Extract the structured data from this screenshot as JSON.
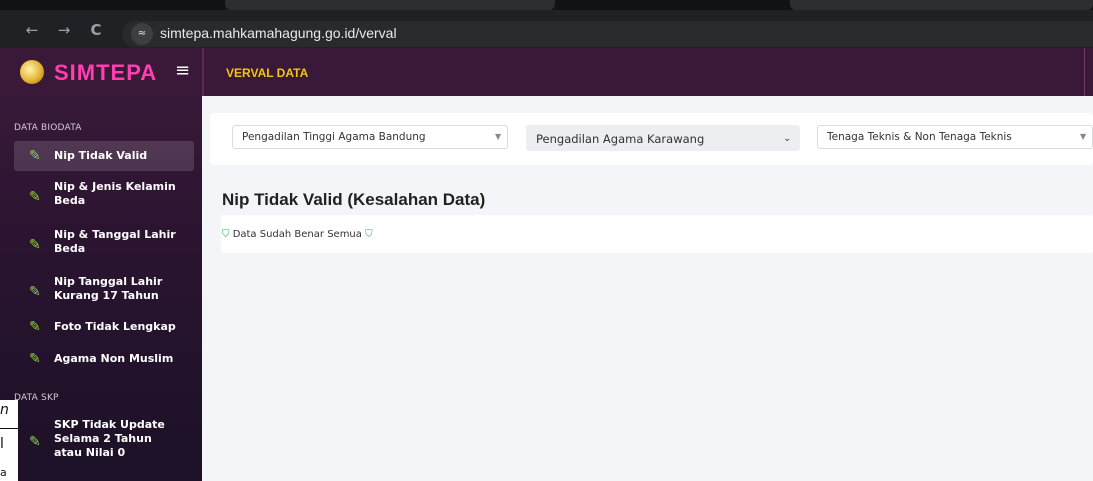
{
  "browser": {
    "url": "simtepa.mahkamahagung.go.id/verval",
    "back_icon": "←",
    "forward_icon": "→",
    "reload_icon": "C",
    "site_icon": "≈"
  },
  "brand": {
    "name": "SIMTEPA",
    "menu_icon": "≡"
  },
  "header": {
    "title": "VERVAL DATA"
  },
  "sidebar": {
    "sections": [
      {
        "label": "DATA BIODATA"
      },
      {
        "label": "DATA SKP"
      }
    ],
    "items": [
      {
        "label": "Nip Tidak Valid"
      },
      {
        "label": "Nip & Jenis Kelamin Beda"
      },
      {
        "label": "Nip & Tanggal Lahir Beda"
      },
      {
        "label": "Nip Tanggal Lahir Kurang 17 Tahun"
      },
      {
        "label": "Foto Tidak Lengkap"
      },
      {
        "label": "Agama Non Muslim"
      },
      {
        "label": "SKP Tidak Update Selama 2 Tahun atau Nilai 0"
      }
    ]
  },
  "filters": {
    "pengadilan_tinggi": "Pengadilan Tinggi Agama Bandung",
    "pengadilan_agama": "Pengadilan Agama Karawang",
    "jenis_tenaga": "Tenaga Teknis & Non Tenaga Teknis"
  },
  "main": {
    "title": "Nip Tidak Valid (Kesalahan Data)",
    "message": "Data Sudah Benar Semua"
  },
  "overlay": {
    "t1": "n",
    "t2": "l",
    "t3": "a"
  },
  "colors": {
    "accent": "#f0c419",
    "sidebar": "#3a1838",
    "brand_text": "#ff3fb0",
    "pencil": "#8fd14f",
    "ok": "#2db34a"
  }
}
